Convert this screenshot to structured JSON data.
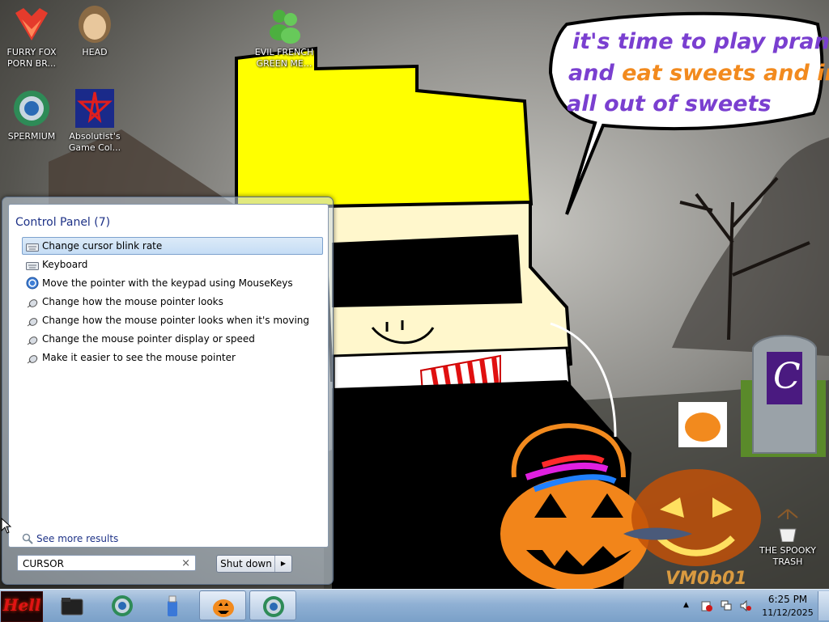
{
  "desktop_icons": [
    {
      "id": "furry-fox",
      "label": "FURRY FOX PORN BR...",
      "icon": "fox-icon"
    },
    {
      "id": "head",
      "label": "HEAD",
      "icon": "head-icon"
    },
    {
      "id": "evil-french",
      "label": "EVIL FRENCH GREEN ME...",
      "icon": "messenger-icon"
    },
    {
      "id": "spermium",
      "label": "SPERMIUM",
      "icon": "chrome-icon"
    },
    {
      "id": "absolutist",
      "label": "Absolutist's Game Col...",
      "icon": "absolutist-icon"
    },
    {
      "id": "spooky-trash",
      "label": "THE SPOOKY TRASH",
      "icon": "trash-icon"
    }
  ],
  "wallpaper": {
    "bubble_line1": "it's time to play pranks",
    "bubble_line2a": "and ",
    "bubble_line2b": "eat sweets and im",
    "bubble_line3": "all out of sweets",
    "tombstone_letter": "C",
    "bucket_text": "VM0b01"
  },
  "start_menu": {
    "section_header": "Control Panel (7)",
    "results": [
      {
        "label": "Change cursor blink rate",
        "icon": "keyboard-icon",
        "selected": true
      },
      {
        "label": "Keyboard",
        "icon": "keyboard-icon",
        "selected": false
      },
      {
        "label": "Move the pointer with the keypad using MouseKeys",
        "icon": "ease-of-access-icon",
        "selected": false
      },
      {
        "label": "Change how the mouse pointer looks",
        "icon": "mouse-icon",
        "selected": false
      },
      {
        "label": "Change how the mouse pointer looks when it's moving",
        "icon": "mouse-icon",
        "selected": false
      },
      {
        "label": "Change the mouse pointer display or speed",
        "icon": "mouse-icon",
        "selected": false
      },
      {
        "label": "Make it easier to see the mouse pointer",
        "icon": "mouse-icon",
        "selected": false
      }
    ],
    "see_more": "See more results",
    "search_value": "CURSOR",
    "search_clear": "×",
    "shutdown_label": "Shut down",
    "shutdown_arrow": "▶"
  },
  "taskbar": {
    "start_label": "Hell",
    "buttons": [
      {
        "name": "explorer",
        "icon": "folder-icon",
        "active": false
      },
      {
        "name": "chrome",
        "icon": "chrome-icon",
        "active": false
      },
      {
        "name": "usb",
        "icon": "usb-icon",
        "active": false
      },
      {
        "name": "pumpkin-app",
        "icon": "pumpkin-icon",
        "active": true
      },
      {
        "name": "chrome-window",
        "icon": "chrome-icon",
        "active": true
      }
    ],
    "tray": {
      "time": "6:25 PM",
      "date": "11/12/2025",
      "show_hidden": "▲"
    }
  }
}
